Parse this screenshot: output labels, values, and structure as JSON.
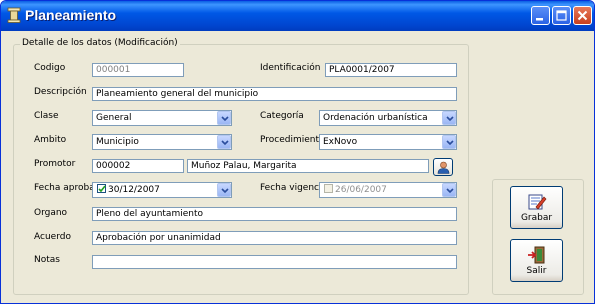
{
  "window": {
    "title": "Planeamiento"
  },
  "group": {
    "legend": "Detalle de los datos (Modificación)"
  },
  "fields": {
    "codigo": {
      "label": "Codigo",
      "value": "000001"
    },
    "identificacion": {
      "label": "Identificación",
      "value": "PLA0001/2007"
    },
    "descripcion": {
      "label": "Descripción",
      "value": "Planeamiento general del municipio"
    },
    "clase": {
      "label": "Clase",
      "value": "General"
    },
    "categoria": {
      "label": "Categoría",
      "value": "Ordenación urbanística"
    },
    "ambito": {
      "label": "Ambito",
      "value": "Municipio"
    },
    "procedimiento": {
      "label": "Procedimiento",
      "value": "ExNovo"
    },
    "promotor": {
      "label": "Promotor",
      "code": "000002",
      "name": "Muñoz Palau, Margarita"
    },
    "fecha_aprobacion": {
      "label": "Fecha aprobació",
      "value": "30/12/2007",
      "checked": true
    },
    "fecha_vigencia": {
      "label": "Fecha vigencia",
      "value": "26/06/2007",
      "checked": false
    },
    "organo": {
      "label": "Organo",
      "value": "Pleno del ayuntamiento"
    },
    "acuerdo": {
      "label": "Acuerdo",
      "value": "Aprobación por unanimidad"
    },
    "notas": {
      "label": "Notas",
      "value": ""
    }
  },
  "buttons": {
    "grabar": "Grabar",
    "salir": "Salir"
  },
  "icons": {
    "app": "column-icon",
    "minimize": "minimize-icon",
    "maximize": "maximize-icon",
    "close": "close-icon",
    "lookup": "person-lookup-icon",
    "grabar": "save-edit-icon",
    "salir": "exit-door-icon"
  },
  "colors": {
    "titlebar": "#0058e6",
    "window_bg": "#ece9d8",
    "field_border": "#7f9db9",
    "close_button": "#c8401e"
  }
}
